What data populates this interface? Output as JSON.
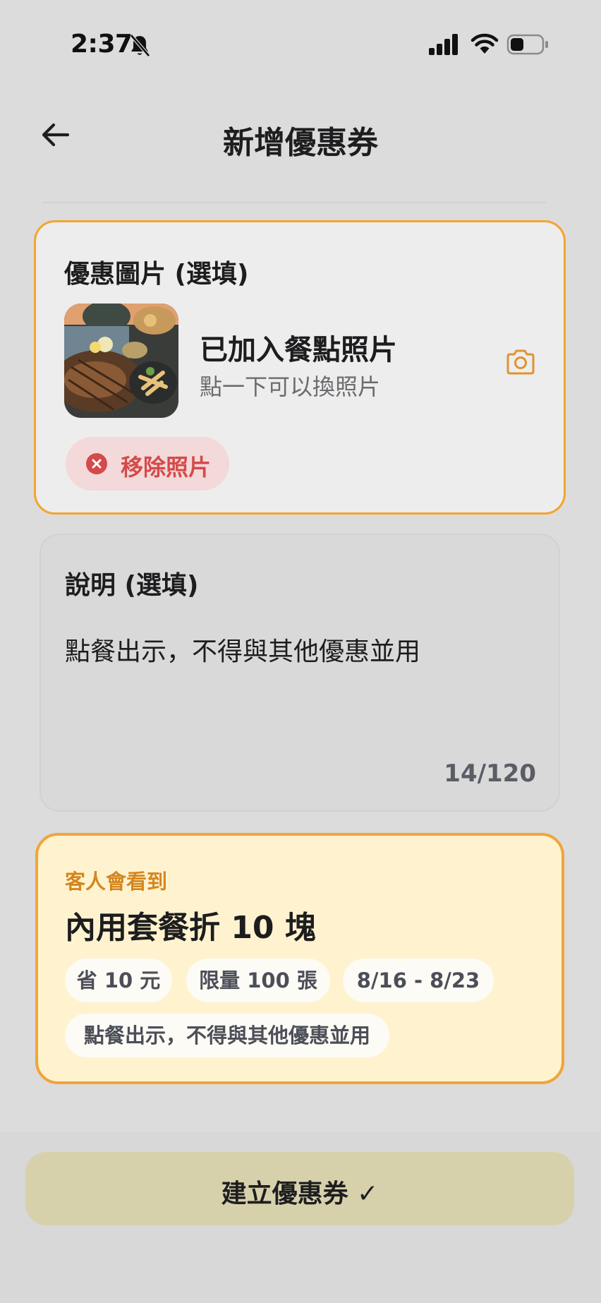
{
  "status_bar": {
    "time": "2:37",
    "icons": [
      "bell-off-icon",
      "signal-icon",
      "wifi-icon",
      "battery-icon"
    ]
  },
  "header": {
    "title": "新增優惠券",
    "back_icon": "arrow-left-icon"
  },
  "photo_section": {
    "title": "優惠圖片 (選填)",
    "status": "已加入餐點照片",
    "hint": "點一下可以換照片",
    "camera_icon": "camera-icon",
    "remove_label": "移除照片",
    "remove_icon": "close-circle-icon"
  },
  "description_section": {
    "title": "說明 (選填)",
    "value": "點餐出示，不得與其他優惠並用",
    "char_count": "14/120"
  },
  "preview": {
    "eyebrow": "客人會看到",
    "title": "內用套餐折 10 塊",
    "chips": [
      "省 10 元",
      "限量 100 張",
      "8/16 - 8/23",
      "點餐出示，不得與其他優惠並用"
    ]
  },
  "actions": {
    "create_label": "建立優惠券 ✓"
  },
  "colors": {
    "accent": "#f3a42f",
    "remove_red": "#d44a4a",
    "preview_bg": "#fff3cf",
    "button_bg": "#d7d1ab"
  }
}
